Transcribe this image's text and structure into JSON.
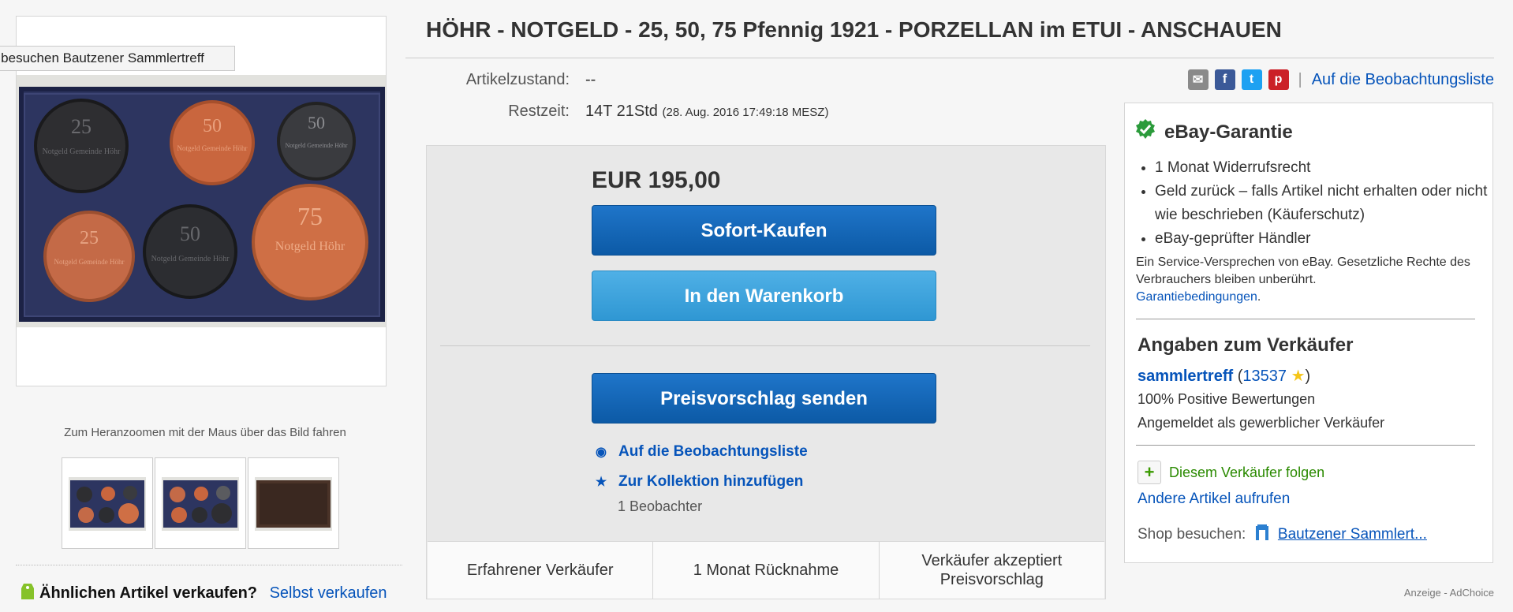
{
  "gallery": {
    "tooltip": "o besuchen Bautzener Sammlertreff",
    "zoom_hint": "Zum Heranzoomen mit der Maus über das Bild fahren",
    "sell_similar_label": "Ähnlichen Artikel verkaufen?",
    "sell_self_link": "Selbst verkaufen",
    "coin_numbers": {
      "c1": "25",
      "c2": "50",
      "c3": "50",
      "c4": "25",
      "c5": "50",
      "c6": "75"
    },
    "coin_texts": {
      "c1": "Notgeld Gemeinde Höhr",
      "c2": "Notgeld Gemeinde Höhr",
      "c3": "Notgeld Gemeinde Höhr",
      "c4": "Notgeld Gemeinde Höhr",
      "c5": "Notgeld Gemeinde Höhr",
      "c6": "Notgeld Höhr"
    }
  },
  "item": {
    "title": "HÖHR - NOTGELD - 25, 50, 75 Pfennig 1921 - PORZELLAN im ETUI - ANSCHAUEN",
    "condition_label": "Artikelzustand:",
    "condition_value": "--",
    "time_label": "Restzeit:",
    "time_value": "14T 21Std",
    "time_end": "(28. Aug. 2016   17:49:18 MESZ)"
  },
  "share": {
    "email_icon": "email-icon",
    "facebook_icon": "facebook-icon",
    "twitter_icon": "twitter-icon",
    "pinterest_icon": "pinterest-icon",
    "separator": "|",
    "watch_link": "Auf die Beobachtungsliste",
    "colors": {
      "email": "#8a8a8a",
      "facebook": "#3b5998",
      "twitter": "#1da1f2",
      "pinterest": "#cb2027"
    }
  },
  "buybox": {
    "price": "EUR 195,00",
    "buy_now": "Sofort-Kaufen",
    "add_to_cart": "In den Warenkorb",
    "make_offer": "Preisvorschlag senden",
    "watch_action": "Auf die Beobachtungsliste",
    "collection_action": "Zur Kollektion hinzufügen",
    "watchers": "1 Beobachter",
    "features": [
      "Erfahrener Verkäufer",
      "1 Monat Rücknahme",
      "Verkäufer akzeptiert\nPreisvorschlag"
    ]
  },
  "guarantee": {
    "title": "eBay-Garantie",
    "items": [
      "1 Monat Widerrufsrecht",
      "Geld zurück – falls Artikel nicht erhalten oder nicht wie beschrieben (Käuferschutz)",
      "eBay-geprüfter Händler"
    ],
    "note": "Ein Service-Versprechen von eBay. Gesetzliche Rechte des Verbrauchers bleiben unberührt.",
    "terms_link": "Garantiebedingungen",
    "terms_dot": "."
  },
  "seller": {
    "title": "Angaben zum Verkäufer",
    "name": "sammlertreff",
    "paren_open": "(",
    "score": "13537",
    "paren_close": ")",
    "positive": "100% Positive Bewertungen",
    "registered": "Angemeldet als gewerblicher Verkäufer",
    "follow": "Diesem Verkäufer folgen",
    "other_items": "Andere Artikel aufrufen",
    "shop_label": "Shop besuchen:",
    "shop_link": "Bautzener Sammlert..."
  },
  "ad": {
    "label": "Anzeige - AdChoice"
  }
}
